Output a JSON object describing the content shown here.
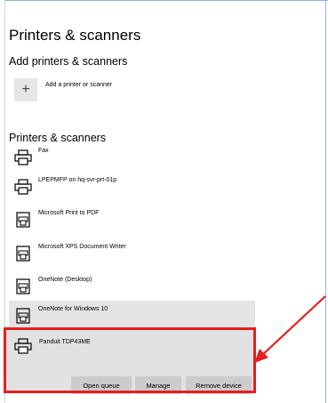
{
  "page_title": "Printers & scanners",
  "add_section": {
    "title": "Add printers & scanners",
    "add_button_icon": "plus-icon",
    "add_label": "Add a printer or scanner"
  },
  "list_section": {
    "title": "Printers & scanners",
    "printers": [
      {
        "name": "Fax",
        "icon": "printer-icon"
      },
      {
        "name": "LPEPMFP on hq-svr-prt-01p",
        "icon": "printer-icon"
      },
      {
        "name": "Microsoft Print to PDF",
        "icon": "document-printer-icon"
      },
      {
        "name": "Microsoft XPS Document Writer",
        "icon": "document-printer-icon"
      },
      {
        "name": "OneNote (Desktop)",
        "icon": "document-printer-icon"
      },
      {
        "name": "OneNote for Windows 10",
        "icon": "document-printer-icon"
      }
    ]
  },
  "selected_printer": {
    "name": "Panduit TDP43ME",
    "icon": "printer-icon",
    "buttons": {
      "open_queue": "Open queue",
      "manage": "Manage",
      "remove_device": "Remove device"
    }
  },
  "colors": {
    "highlight": "#e61e1e",
    "accent_edge": "#8cb4e0",
    "selected_bg": "#e2e2e2",
    "button_bg": "#cccccc"
  }
}
